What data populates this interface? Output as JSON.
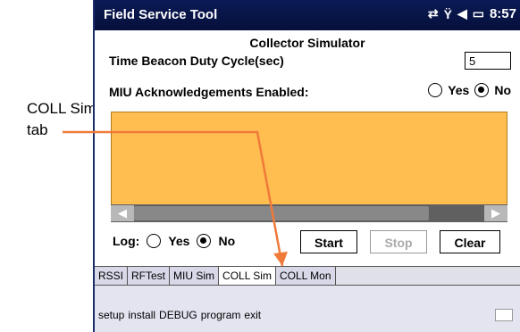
{
  "callout": {
    "line1": "COLL Sim",
    "line2": "tab"
  },
  "titlebar": {
    "app": "Field Service Tool",
    "time": "8:57"
  },
  "screen": {
    "heading": "Collector Simulator",
    "duty_label": "Time Beacon Duty Cycle(sec)",
    "duty_value": "5",
    "ack_label": "MIU Acknowledgements Enabled:",
    "ack_yes": "Yes",
    "ack_no": "No",
    "ack_selected": "No",
    "log_label": "Log:",
    "log_yes": "Yes",
    "log_no": "No",
    "log_selected": "No",
    "start": "Start",
    "stop": "Stop",
    "clear": "Clear"
  },
  "tabs": [
    {
      "label": "RSSI"
    },
    {
      "label": "RFTest"
    },
    {
      "label": "MIU Sim"
    },
    {
      "label": "COLL Sim",
      "active": true
    },
    {
      "label": "COLL Mon"
    }
  ],
  "menu": [
    "setup",
    "install",
    "DEBUG",
    "program",
    "exit"
  ],
  "colors": {
    "panel": "#ffbe4f",
    "titlebar": "#0a1a55",
    "arrow": "#f07a3a"
  }
}
